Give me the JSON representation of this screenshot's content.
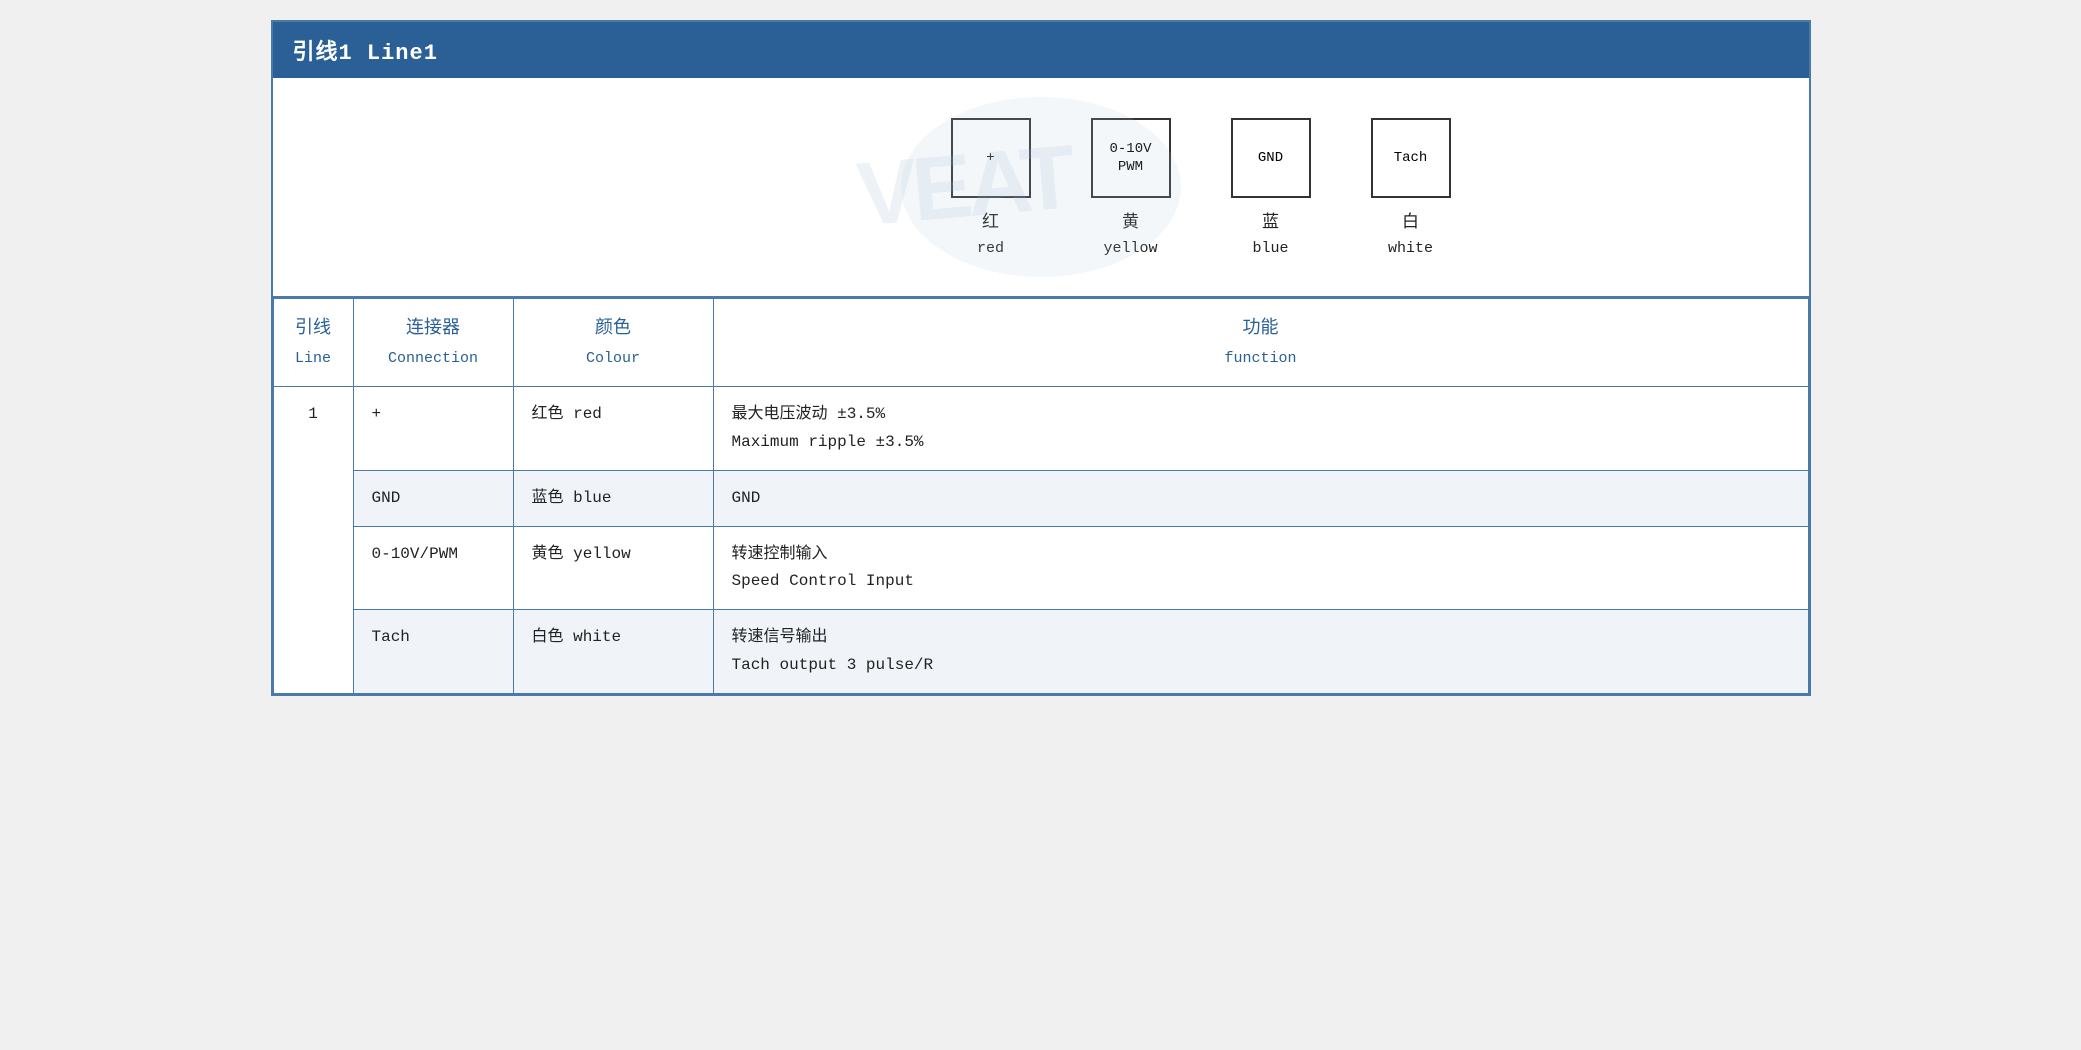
{
  "title": "引线1 Line1",
  "diagram": {
    "connectors": [
      {
        "id": "plus",
        "symbol": "+",
        "chinese": "红",
        "english": "red"
      },
      {
        "id": "pwm",
        "symbol": "0-10V\nPWM",
        "chinese": "黄",
        "english": "yellow"
      },
      {
        "id": "gnd",
        "symbol": "GND",
        "chinese": "蓝",
        "english": "blue"
      },
      {
        "id": "tach",
        "symbol": "Tach",
        "chinese": "白",
        "english": "white"
      }
    ]
  },
  "table": {
    "headers": {
      "line_chinese": "引线",
      "line_english": "Line",
      "connection_chinese": "连接器",
      "connection_english": "Connection",
      "colour_chinese": "颜色",
      "colour_english": "Colour",
      "function_chinese": "功能",
      "function_english": "function"
    },
    "rows": [
      {
        "line": "1",
        "rowspan": 4,
        "connection": "+",
        "colour_chinese": "红色",
        "colour_english": "red",
        "function_chinese": "最大电压波动 ±3.5%",
        "function_english": "Maximum ripple ±3.5%",
        "alt": false
      },
      {
        "connection": "GND",
        "colour_chinese": "蓝色",
        "colour_english": "blue",
        "function_chinese": "GND",
        "function_english": "",
        "alt": true
      },
      {
        "connection": "0-10V/PWM",
        "colour_chinese": "黄色",
        "colour_english": "yellow",
        "function_chinese": "转速控制输入",
        "function_english": "Speed Control Input",
        "alt": false
      },
      {
        "connection": "Tach",
        "colour_chinese": "白色",
        "colour_english": "white",
        "function_chinese": "转速信号输出",
        "function_english": "Tach output 3 pulse/R",
        "alt": true
      }
    ]
  },
  "watermark": "VEAT"
}
